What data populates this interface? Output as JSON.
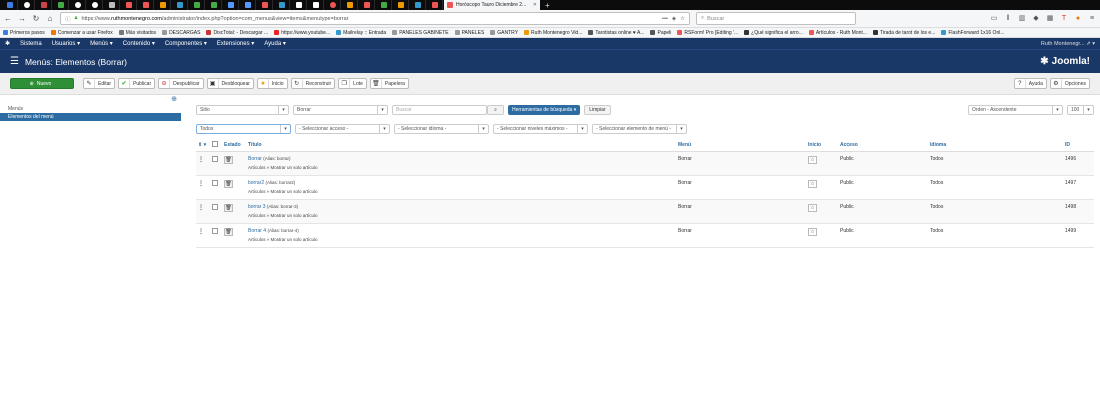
{
  "browser": {
    "active_tab_title": "Horóscopo Tauro Diciembre 2...",
    "url_prefix": "https://www.",
    "url_host": "ruthmontenegro.com",
    "url_rest": "/administrator/index.php?option=com_menus&view=items&menutype=borrar",
    "search_placeholder": "Buscar",
    "bookmarks": [
      "Primeros pasos",
      "Comenzar a usar Firefox",
      "Más visitados",
      "DESCARGAS",
      "DiscTotal: - Descargar ...",
      "https://www.youtube...",
      "Mailrelay :: Entrada",
      "PANELES GABINETE",
      "PANELES",
      "GANTRY",
      "Ruth Montenegro Vid...",
      "Tarotistas online ♥ A...",
      "Papeli",
      "RSForm! Pro [Editing '...",
      "¿Qué significa el arro...",
      "Artículos - Ruth Mont...",
      "Tirada de tarot de los e...",
      "FlashForward 1x16 Onl..."
    ]
  },
  "adminbar": {
    "menus": [
      "Sistema",
      "Usuarios",
      "Menús",
      "Contenido",
      "Componentes",
      "Extensiones",
      "Ayuda"
    ],
    "user": "Ruth Montenegr..."
  },
  "header": {
    "title": "Menús: Elementos (Borrar)",
    "logo": "Joomla!"
  },
  "toolbar": {
    "new": "Nuevo",
    "edit": "Editar",
    "publish": "Publicar",
    "unpublish": "Despublicar",
    "unlock": "Desbloquear",
    "home": "Inicio",
    "rebuild": "Reconstruir",
    "batch": "Lote",
    "trash": "Papelera",
    "help": "Ayuda",
    "options": "Opciones"
  },
  "sidebar": {
    "items": [
      "Menús",
      "Elementos del menú"
    ]
  },
  "filters": {
    "site": "Sitio",
    "menu": "Borrar",
    "search_placeholder": "Buscar",
    "search_tools": "Herramientas de búsqueda ▾",
    "clear": "Limpiar",
    "ordering": "Orden - Ascendente",
    "limit": "100",
    "state": "Todos",
    "access": "- Seleccionar acceso -",
    "language": "- Seleccionar idioma -",
    "levels": "- Seleccionar niveles máximos -",
    "parent": "- Seleccionar elemento de menú -"
  },
  "table": {
    "columns": {
      "state": "Estado",
      "title": "Título",
      "menu": "Menú",
      "home": "Inicio",
      "access": "Acceso",
      "language": "Idioma",
      "id": "ID"
    },
    "rows": [
      {
        "title": "Borrar",
        "alias": "(Alias: borrar)",
        "type": "Artículos » Mostrar un solo artículo",
        "menu": "Borrar",
        "access": "Public",
        "language": "Todos",
        "id": "1496"
      },
      {
        "title": "borrar2",
        "alias": "(Alias: borrar2)",
        "type": "Artículos » Mostrar un solo artículo",
        "menu": "Borrar",
        "access": "Public",
        "language": "Todos",
        "id": "1497"
      },
      {
        "title": "borrar 3",
        "alias": "(Alias: borrar-3)",
        "type": "Artículos » Mostrar un solo artículo",
        "menu": "Borrar",
        "access": "Public",
        "language": "Todos",
        "id": "1498"
      },
      {
        "title": "Borrar 4",
        "alias": "(Alias: borrar-4)",
        "type": "Artículos » Mostrar un solo artículo",
        "menu": "Borrar",
        "access": "Public",
        "language": "Todos",
        "id": "1499"
      }
    ]
  }
}
